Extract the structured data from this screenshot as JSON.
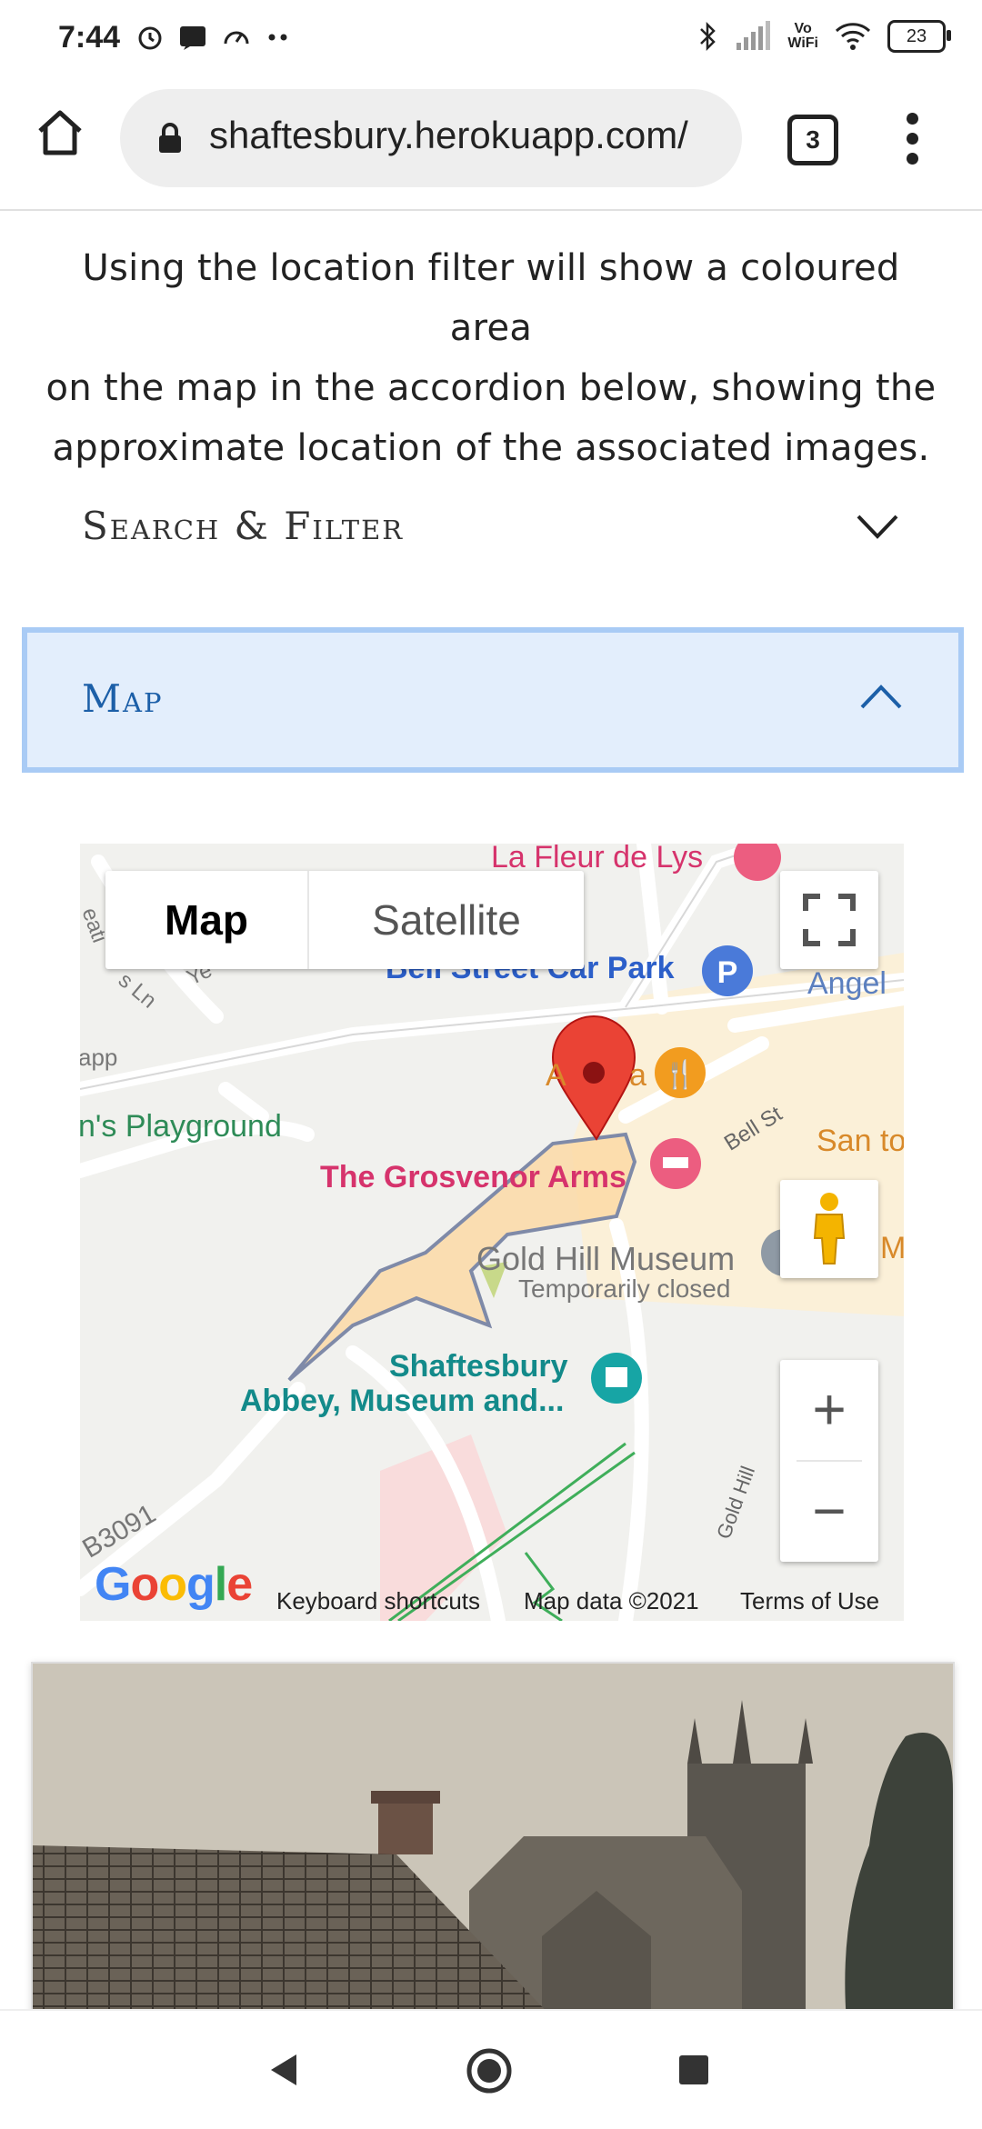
{
  "status": {
    "time": "7:44",
    "battery": "23",
    "vowifi_line1": "Vo",
    "vowifi_line2": "WiFi"
  },
  "browser": {
    "url": "shaftesbury.herokuapp.com/",
    "tab_count": "3"
  },
  "content": {
    "intro_line1": "Using the location filter will show a coloured area",
    "intro_line2": "on the map in the accordion below, showing the",
    "intro_line3": "approximate location of the associated images.",
    "search_filter_label": "Search & Filter",
    "map_accordion_label": "Map"
  },
  "map": {
    "toggle_map": "Map",
    "toggle_satellite": "Satellite",
    "zoom_in": "+",
    "zoom_out": "−",
    "labels": {
      "la_fleur": "La Fleur de Lys",
      "bell_street_car_park": "Bell Street Car Park",
      "angel": "Angel",
      "app": "app",
      "playground": "n's Playground",
      "grosvenor": "The Grosvenor Arms",
      "bell_st": "Bell St",
      "san": "San to",
      "gold_hill_museum": "Gold Hill Museum",
      "temporarily_closed": "Temporarily closed",
      "abbey_line1": "Shaftesbury",
      "abbey_line2": "Abbey, Museum and...",
      "gold_hill": "Gold Hill",
      "b3091": "B3091",
      "a_partial": "A",
      "a_partial2": "a",
      "m_partial": "M",
      "eat_partial": "eati",
      "ln_partial": "s Ln",
      "ye_partial": "Ye"
    },
    "google": "Google",
    "keyboard_shortcuts": "Keyboard shortcuts",
    "map_data": "Map data ©2021",
    "terms": "Terms of Use"
  },
  "colors": {
    "accordion_active_bg": "#e3eefc",
    "accordion_active_border": "#a9cbf5",
    "accordion_active_text": "#1c5fa8",
    "area_fill": "#fbd9a6",
    "area_stroke": "#7f8aa8",
    "pin": "#ea4335"
  }
}
